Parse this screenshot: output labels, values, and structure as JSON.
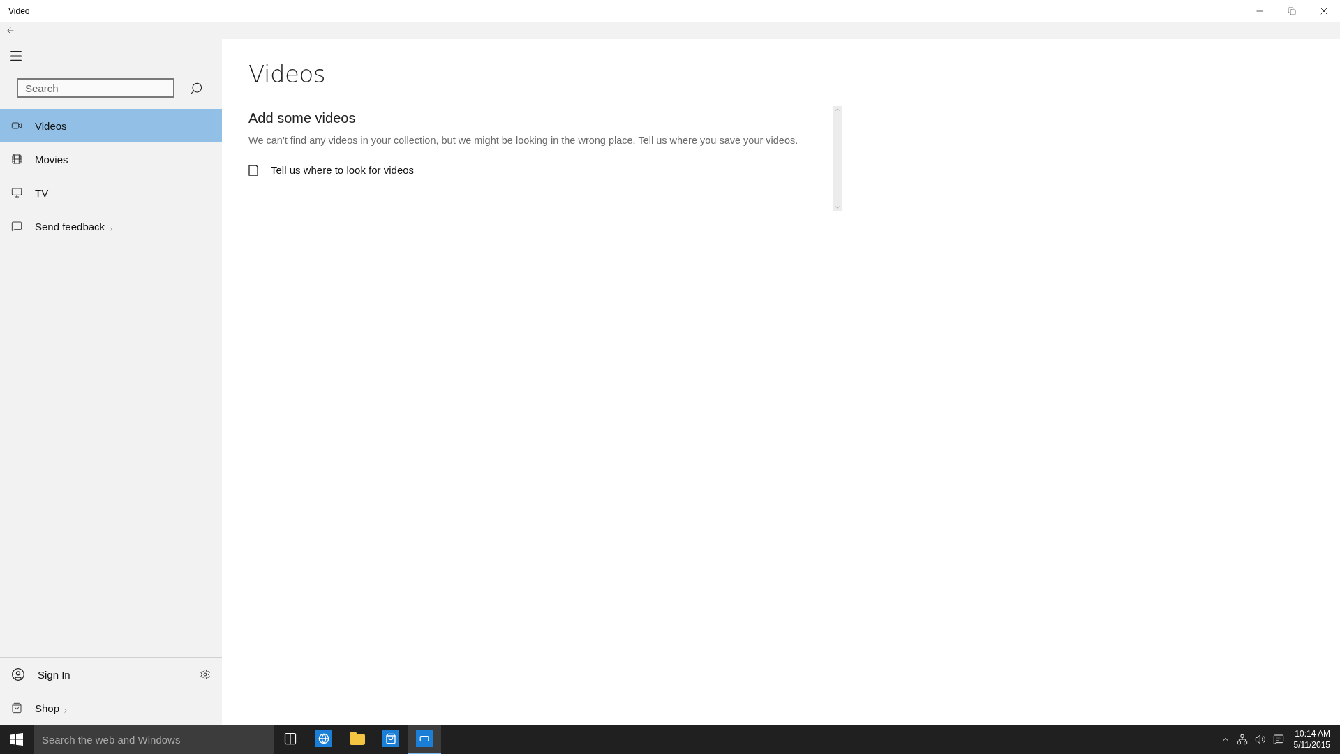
{
  "window": {
    "title": "Video"
  },
  "sidebar": {
    "search": {
      "placeholder": "Search"
    },
    "items": [
      {
        "kind": "videos",
        "label": "Videos",
        "selected": true,
        "chevron": false
      },
      {
        "kind": "movies",
        "label": "Movies",
        "selected": false,
        "chevron": false
      },
      {
        "kind": "tv",
        "label": "TV",
        "selected": false,
        "chevron": false
      },
      {
        "kind": "feedback",
        "label": "Send feedback",
        "selected": false,
        "chevron": true
      }
    ],
    "footer": [
      {
        "kind": "account",
        "label": "Sign In",
        "chevron": false
      },
      {
        "kind": "shop",
        "label": "Shop",
        "chevron": true
      }
    ]
  },
  "main": {
    "title": "Videos",
    "heading": "Add some videos",
    "description": "We can't find any videos in your collection, but we might be looking in the wrong place. Tell us where you save your videos.",
    "action": "Tell us where to look for videos"
  },
  "taskbar": {
    "search": {
      "placeholder": "Search the web and Windows"
    },
    "apps": [
      {
        "kind": "taskview",
        "selected": false
      },
      {
        "kind": "browser",
        "selected": false
      },
      {
        "kind": "explorer",
        "selected": false
      },
      {
        "kind": "store",
        "selected": false
      },
      {
        "kind": "video",
        "selected": true
      }
    ],
    "clock": {
      "time": "10:14 AM",
      "date": "5/11/2015"
    }
  }
}
